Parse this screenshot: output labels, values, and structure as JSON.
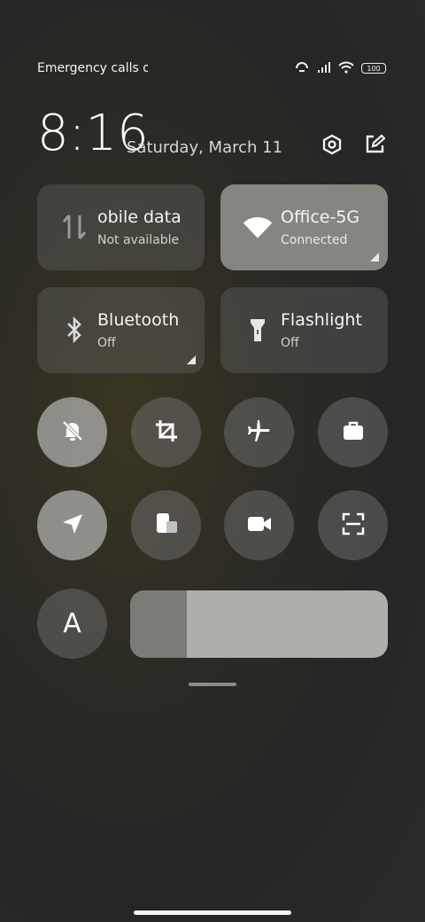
{
  "status": {
    "carrier_text": "Emergency calls o",
    "battery_level": "100"
  },
  "clock": {
    "time": "8:16",
    "date": "Saturday, March 11"
  },
  "tiles": [
    {
      "title": "obile data",
      "subtitle": "Not available",
      "icon": "mobile-data-icon",
      "active": false
    },
    {
      "title": "Office-5G",
      "subtitle": "Connected",
      "icon": "wifi-icon",
      "active": true
    },
    {
      "title": "Bluetooth",
      "subtitle": "Off",
      "icon": "bluetooth-icon",
      "active": false
    },
    {
      "title": "Flashlight",
      "subtitle": "Off",
      "icon": "flashlight-icon",
      "active": false
    }
  ],
  "toggles": [
    {
      "icon": "silent-bell-icon",
      "active": true
    },
    {
      "icon": "screenshot-crop-icon",
      "active": false
    },
    {
      "icon": "airplane-icon",
      "active": false
    },
    {
      "icon": "briefcase-icon",
      "active": false
    },
    {
      "icon": "location-icon",
      "active": true
    },
    {
      "icon": "floating-window-icon",
      "active": false
    },
    {
      "icon": "screen-record-icon",
      "active": false
    },
    {
      "icon": "scan-icon",
      "active": false
    }
  ],
  "font_toggle": {
    "label": "A"
  },
  "brightness": {
    "level_fraction": 0.22
  },
  "colors": {
    "tile_inactive": "#5a5a58",
    "tile_active": "#9a9a96",
    "text": "#f5f5f5"
  }
}
